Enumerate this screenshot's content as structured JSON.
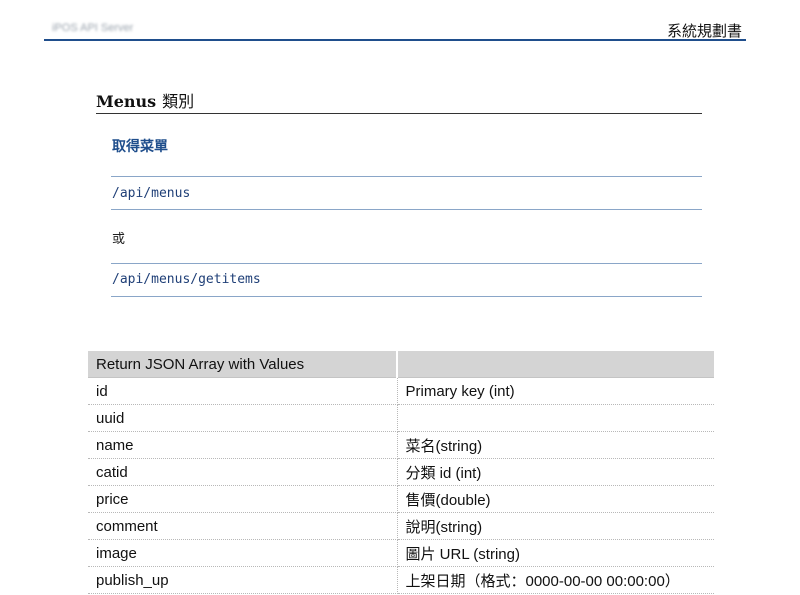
{
  "header": {
    "left_text": "iPOS API Server",
    "right_text": "系統規劃書"
  },
  "section": {
    "title": "Menus",
    "title_zh": "類別"
  },
  "api": {
    "heading": "取得菜單",
    "path_1": "/api/menus",
    "or_text": "或",
    "path_2": "/api/menus/getitems"
  },
  "table": {
    "header": [
      "Return JSON Array with Values",
      ""
    ],
    "rows": [
      [
        "id",
        "Primary key (int)"
      ],
      [
        "uuid",
        ""
      ],
      [
        "name",
        "菜名(string)"
      ],
      [
        "catid",
        "分類 id (int)"
      ],
      [
        "price",
        "售價(double)"
      ],
      [
        "comment",
        "說明(string)"
      ],
      [
        "image",
        "圖片 URL (string)"
      ],
      [
        "publish_up",
        "上架日期（格式：0000-00-00 00:00:00）"
      ]
    ]
  }
}
